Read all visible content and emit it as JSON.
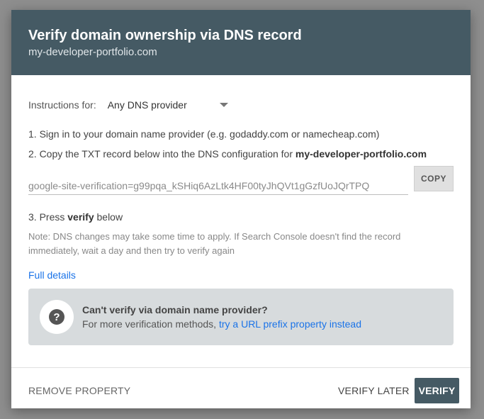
{
  "dialog": {
    "title": "Verify domain ownership via DNS record",
    "subtitle": "my-developer-portfolio.com"
  },
  "instructions": {
    "label": "Instructions for:",
    "selected_provider": "Any DNS provider"
  },
  "steps": {
    "step1": "1. Sign in to your domain name provider (e.g. godaddy.com or namecheap.com)",
    "step2_prefix": "2. Copy the TXT record below into the DNS configuration for ",
    "step2_domain": "my-developer-portfolio.com",
    "step3_prefix": "3. Press ",
    "step3_bold": "verify",
    "step3_suffix": " below"
  },
  "txt_record": {
    "value": "google-site-verification=g99pqa_kSHiq6AzLtk4HF00tyJhQVt1gGzfUoJQrTPQ",
    "copy_label": "COPY"
  },
  "note": "Note: DNS changes may take some time to apply. If Search Console doesn't find the record immediately, wait a day and then try to verify again",
  "full_details": "Full details",
  "alt_method": {
    "title": "Can't verify via domain name provider?",
    "desc_prefix": "For more verification methods, ",
    "link": "try a URL prefix property instead"
  },
  "footer": {
    "remove": "REMOVE PROPERTY",
    "later": "VERIFY LATER",
    "verify": "VERIFY"
  },
  "colors": {
    "header": "#455a64",
    "link": "#1a73e8",
    "info_box": "#d7dbdd"
  }
}
